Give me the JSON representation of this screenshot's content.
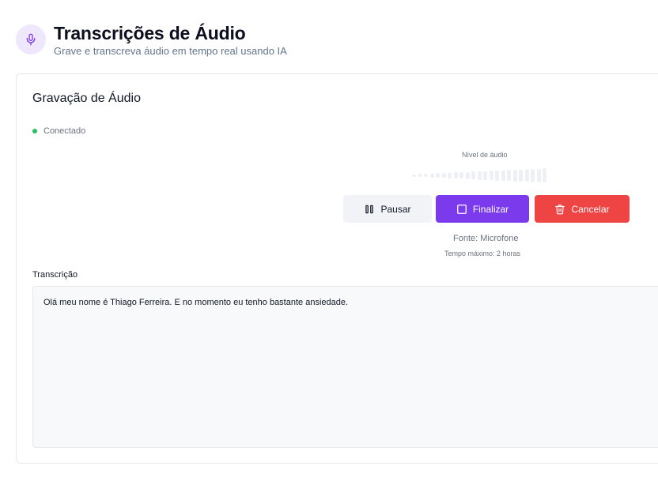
{
  "header": {
    "icon": "microphone-icon",
    "title": "Transcrições de Áudio",
    "subtitle": "Grave e transcreva áudio em tempo real usando IA"
  },
  "card": {
    "title": "Gravação de Áudio",
    "status": {
      "text": "Conectado",
      "color": "#22c55e"
    },
    "audio_level": {
      "label": "Nível de áudio",
      "bar_count": 23,
      "active_bars": 0
    },
    "buttons": {
      "pause": {
        "label": "Pausar",
        "icon": "pause-icon"
      },
      "finish": {
        "label": "Finalizar",
        "icon": "stop-square-icon",
        "color": "#7c3aed"
      },
      "cancel": {
        "label": "Cancelar",
        "icon": "trash-icon",
        "color": "#ef4444"
      }
    },
    "source": "Fonte: Microfone",
    "max_time": "Tempo máximo: 2 horas"
  },
  "transcription": {
    "label": "Transcrição",
    "text": "Olá meu nome é Thiago Ferreira. E no momento eu tenho bastante ansiedade."
  }
}
